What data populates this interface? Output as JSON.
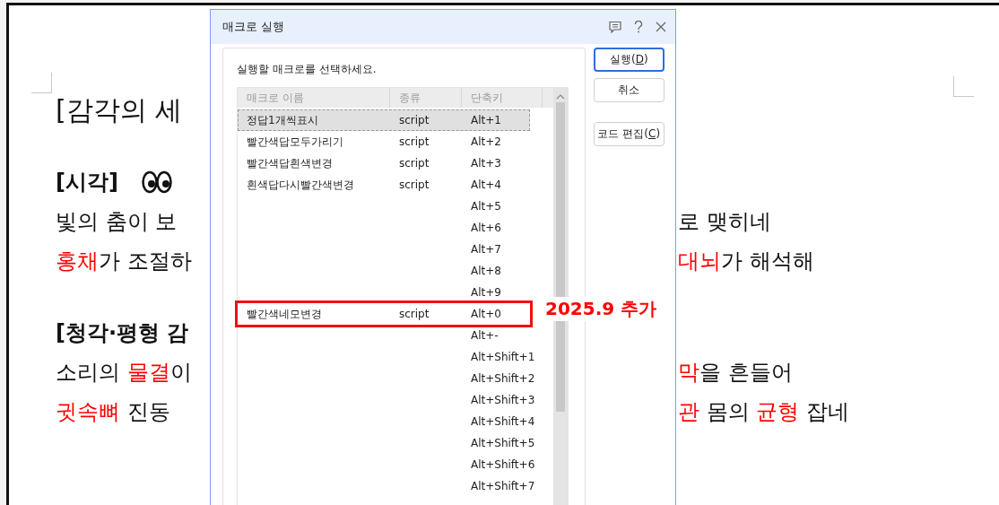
{
  "document": {
    "lines": [
      {
        "kind": "title",
        "left": [
          {
            "text": "[감각의 세",
            "red": false
          }
        ]
      },
      {
        "kind": "heading",
        "left": [
          {
            "text": "[시각]",
            "red": false
          }
        ],
        "eyes": true
      },
      {
        "kind": "body",
        "left": [
          {
            "text": "빛의 춤이 보",
            "red": false
          }
        ],
        "right": [
          {
            "text": "로 맺히네",
            "red": false
          }
        ]
      },
      {
        "kind": "body",
        "left": [
          {
            "text": "홍채",
            "red": true
          },
          {
            "text": "가 조절하",
            "red": false
          }
        ],
        "right": [
          {
            "text": "대뇌",
            "red": true
          },
          {
            "text": "가 해석해",
            "red": false
          }
        ]
      },
      {
        "kind": "heading",
        "left": [
          {
            "text": "[청각·평형 감",
            "red": false
          }
        ]
      },
      {
        "kind": "body",
        "left": [
          {
            "text": "소리의 ",
            "red": false
          },
          {
            "text": "물결",
            "red": true
          },
          {
            "text": "이",
            "red": false
          }
        ],
        "right": [
          {
            "text": "막",
            "red": true
          },
          {
            "text": "을 흔들어",
            "red": false
          }
        ]
      },
      {
        "kind": "body",
        "left": [
          {
            "text": "귓속뼈",
            "red": true
          },
          {
            "text": " 진동",
            "red": false
          }
        ],
        "right": [
          {
            "text": "관",
            "red": true
          },
          {
            "text": " 몸의 ",
            "red": false
          },
          {
            "text": "균형",
            "red": true
          },
          {
            "text": " 잡네",
            "red": false
          }
        ]
      }
    ]
  },
  "dialog": {
    "title": "매크로 실행",
    "prompt": "실행할 매크로를 선택하세요.",
    "columns": [
      "매크로 이름",
      "종류",
      "단축키"
    ],
    "rows": [
      {
        "name": "정답1개씩표시",
        "type": "script",
        "key": "Alt+1",
        "selected": true,
        "annotated": false
      },
      {
        "name": "빨간색답모두가리기",
        "type": "script",
        "key": "Alt+2",
        "selected": false,
        "annotated": false
      },
      {
        "name": "빨간색답흰색변경",
        "type": "script",
        "key": "Alt+3",
        "selected": false,
        "annotated": false
      },
      {
        "name": "흰색답다시빨간색변경",
        "type": "script",
        "key": "Alt+4",
        "selected": false,
        "annotated": false
      },
      {
        "key": "Alt+5",
        "selected": false,
        "annotated": false
      },
      {
        "key": "Alt+6",
        "selected": false,
        "annotated": false
      },
      {
        "key": "Alt+7",
        "selected": false,
        "annotated": false
      },
      {
        "key": "Alt+8",
        "selected": false,
        "annotated": false
      },
      {
        "key": "Alt+9",
        "selected": false,
        "annotated": false
      },
      {
        "name": "빨간색네모변경",
        "type": "script",
        "key": "Alt+0",
        "selected": false,
        "annotated": true
      },
      {
        "key": "Alt+-",
        "selected": false,
        "annotated": false
      },
      {
        "key": "Alt+Shift+1",
        "selected": false,
        "annotated": false
      },
      {
        "key": "Alt+Shift+2",
        "selected": false,
        "annotated": false
      },
      {
        "key": "Alt+Shift+3",
        "selected": false,
        "annotated": false
      },
      {
        "key": "Alt+Shift+4",
        "selected": false,
        "annotated": false
      },
      {
        "key": "Alt+Shift+5",
        "selected": false,
        "annotated": false
      },
      {
        "key": "Alt+Shift+6",
        "selected": false,
        "annotated": false
      },
      {
        "key": "Alt+Shift+7",
        "selected": false,
        "annotated": false
      }
    ],
    "buttons": [
      {
        "before": "실행(",
        "mnemonic": "D",
        "after": ")",
        "primary": true
      },
      {
        "before": "취소",
        "primary": false
      },
      {
        "before": "코드 편집(",
        "mnemonic": "C",
        "after": ")",
        "primary": false
      }
    ]
  },
  "annotation": {
    "text": "2025.9 추가"
  }
}
